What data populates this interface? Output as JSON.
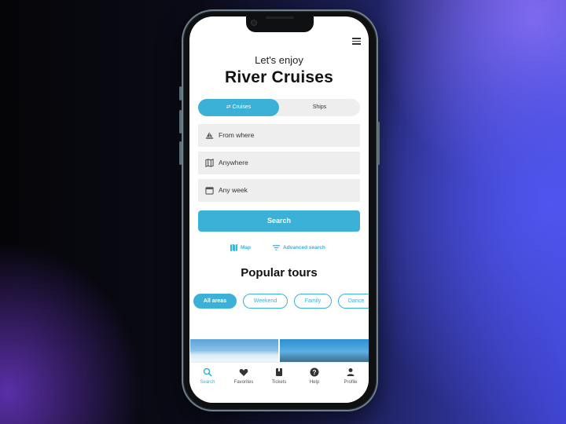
{
  "hero": {
    "greeting": "Let's enjoy",
    "title": "River Cruises"
  },
  "toggle": {
    "active_label": "⇄ Cruises",
    "inactive_label": "Ships"
  },
  "fields": [
    {
      "icon": "sailboat-icon",
      "placeholder": "From where"
    },
    {
      "icon": "map-icon",
      "placeholder": "Anywhere"
    },
    {
      "icon": "calendar-icon",
      "placeholder": "Any week"
    }
  ],
  "search_button": "Search",
  "links": {
    "map": "Map",
    "advanced": "Advanced search"
  },
  "section_title": "Popular tours",
  "chips": [
    {
      "label": "All areas",
      "active": true
    },
    {
      "label": "Weekend",
      "active": false
    },
    {
      "label": "Family",
      "active": false
    },
    {
      "label": "Dance",
      "active": false
    }
  ],
  "tabbar": [
    {
      "label": "Search",
      "icon": "search-icon",
      "active": true
    },
    {
      "label": "Favorites",
      "icon": "heart-icon",
      "active": false
    },
    {
      "label": "Tickets",
      "icon": "ticket-book-icon",
      "active": false
    },
    {
      "label": "Help",
      "icon": "help-icon",
      "active": false
    },
    {
      "label": "Profile",
      "icon": "profile-icon",
      "active": false
    }
  ],
  "colors": {
    "accent": "#3bb1d8",
    "field_bg": "#eeeeee",
    "text": "#111111"
  }
}
